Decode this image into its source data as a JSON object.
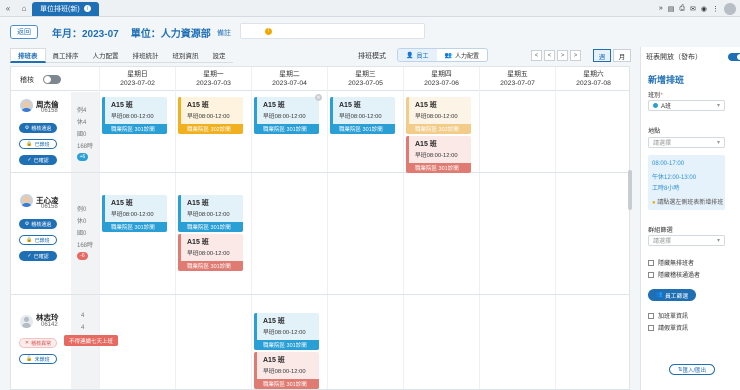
{
  "topbar": {
    "tab_label": "單位排班(新)",
    "tab_info_icon": "i",
    "nav_collapse_icon": "double-chevron-left",
    "home_icon": "home",
    "right_icons": [
      "double-chevron-right",
      "doc-icon",
      "print-icon",
      "chat-icon",
      "eye-icon",
      "more-icon"
    ]
  },
  "header": {
    "back_label": "返回",
    "title": "年月：2023-07",
    "unit": "單位：人力資源部",
    "note_label": "備註",
    "warn_glyph": "!"
  },
  "tabs": [
    "排班表",
    "員工排序",
    "人力配置",
    "排班統計",
    "班別資訊",
    "設定"
  ],
  "mode": {
    "label": "排班模式",
    "options": [
      "員工",
      "人力配置"
    ],
    "selected": "員工"
  },
  "view": {
    "prev_labels": [
      "<",
      "<"
    ],
    "next_labels": [
      ">",
      ">"
    ],
    "week_label": "週",
    "month_label": "月",
    "selected": "週"
  },
  "grid": {
    "toggle_label": "稽核",
    "days": [
      {
        "weekday": "星期日",
        "date": "2023-07-02"
      },
      {
        "weekday": "星期一",
        "date": "2023-07-03"
      },
      {
        "weekday": "星期二",
        "date": "2023-07-04"
      },
      {
        "weekday": "星期三",
        "date": "2023-07-05"
      },
      {
        "weekday": "星期四",
        "date": "2023-07-06"
      },
      {
        "weekday": "星期五",
        "date": "2023-07-07"
      },
      {
        "weekday": "星期六",
        "date": "2023-07-08"
      }
    ],
    "employees": [
      {
        "name": "周杰倫",
        "id": "06158",
        "stats": [
          "例4",
          "休4",
          "國0",
          "168時"
        ],
        "badge": "+6",
        "badge_color": "#2a9fd6",
        "buttons": [
          "稽核通過",
          "已鎖班",
          "已確認"
        ]
      },
      {
        "name": "王心凌",
        "id": "06158",
        "stats": [
          "例0",
          "休0",
          "國0",
          "168時"
        ],
        "badge": "-6",
        "badge_color": "#e66a62",
        "buttons": [
          "稽核通過",
          "已鎖班",
          "已確認"
        ]
      },
      {
        "name": "林志玲",
        "id": "06142",
        "stats": [
          "4",
          "4",
          "",
          ""
        ],
        "badge": "",
        "badge_color": "#2a9fd6",
        "buttons": [
          "稽核異常",
          "未鎖班"
        ],
        "tooltip": "不得連續七天上班"
      }
    ],
    "shift": {
      "name": "A15 班",
      "time": "早班08:00-12:00",
      "room_301": "職業院區 301診間",
      "room_302": "職業院區 302診間"
    }
  },
  "panel": {
    "toggle_label": "班表開放（發布）",
    "title": "新增排班",
    "shift_label": "班別",
    "required_mark": "*",
    "shift_value": "A班",
    "location_label": "地點",
    "location_placeholder": "請選擇",
    "info": [
      "08:00-17:00",
      "午休12:00-13:00",
      "工時8小時"
    ],
    "info_warn": "請點選左側班表新增排班",
    "group_label": "群組篩選",
    "group_placeholder": "請選擇",
    "checks1": [
      "隱藏無排班者",
      "隱藏稽核通過者"
    ],
    "filter_button": "員工篩選",
    "checks2": [
      "加班單資訊",
      "請假單資訊"
    ],
    "io_button": "匯入/匯出"
  },
  "colors": {
    "primary": "#1f6fb5",
    "shift_blue": "#2a9fd6",
    "shift_yellow": "#f0b020",
    "shift_red": "#e07b73"
  }
}
